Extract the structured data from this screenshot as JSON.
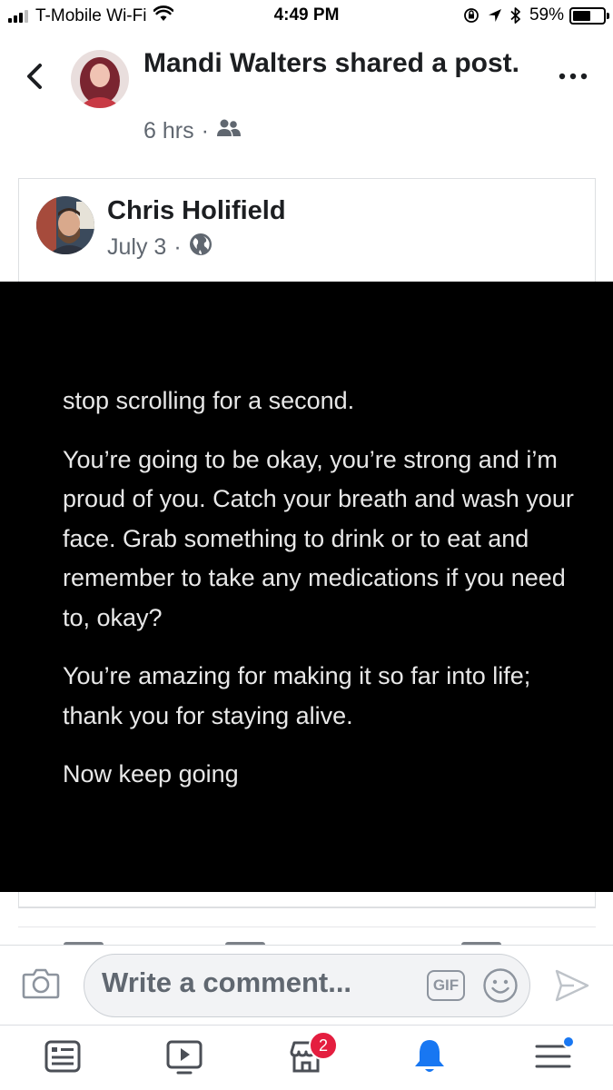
{
  "status_bar": {
    "carrier": "T-Mobile Wi-Fi",
    "time": "4:49 PM",
    "battery": "59%",
    "battery_level": 0.59
  },
  "header": {
    "author": "Mandi Walters",
    "action": "shared a post.",
    "time": "6 hrs",
    "dot": "·",
    "privacy_icon": "friends-icon"
  },
  "shared_post": {
    "author": "Chris Holifield",
    "date": "July 3",
    "dot": "·",
    "privacy_icon": "globe-icon",
    "image_text": [
      "stop scrolling for a second.",
      "You’re going to be okay, you’re strong and i’m proud of you. Catch your breath and wash your face. Grab something to drink or to eat and remember to take any medications if you need to, okay?",
      "You’re amazing for making it so far into life; thank you for staying alive.",
      "Now keep going"
    ]
  },
  "comment": {
    "placeholder": "Write a comment...",
    "gif_label": "GIF"
  },
  "tabs": {
    "notifications_badge": "2",
    "active_tab": "notifications",
    "accent": "#1877f2"
  }
}
